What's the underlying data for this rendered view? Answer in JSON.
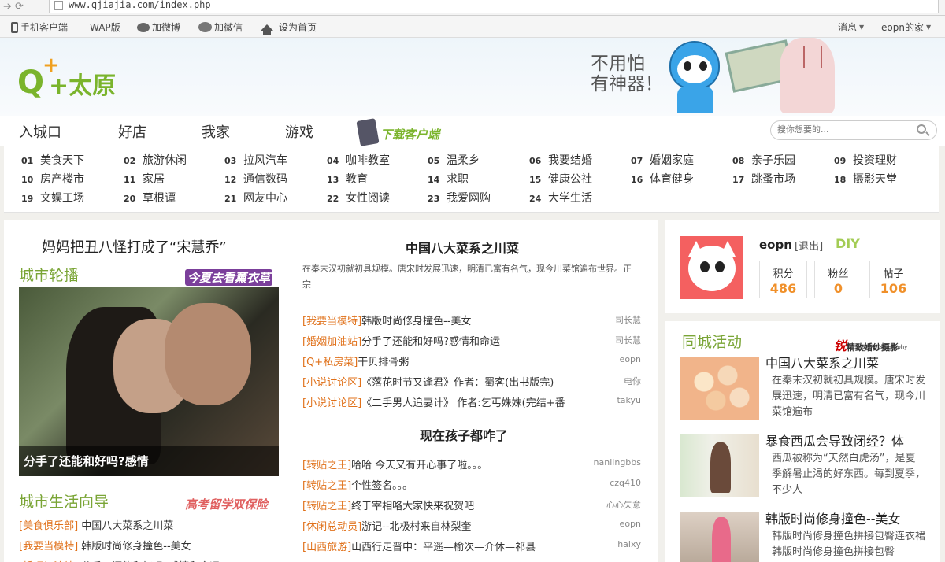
{
  "browser": {
    "url": "www.qjiajia.com/index.php"
  },
  "topbar": {
    "mobile_client": "手机客户端",
    "wap": "WAP版",
    "add_weibo": "加微博",
    "add_weixin": "加微信",
    "set_home": "设为首页",
    "messages": "消息",
    "my_home": "eopn的家"
  },
  "header": {
    "logo_plus": "+",
    "logo_text": "太原",
    "banner_line1": "不用怕",
    "banner_line2": "有神器！"
  },
  "nav": {
    "tabs": [
      "入城口",
      "好店",
      "我家",
      "游戏"
    ],
    "download": "下载客户端",
    "search_placeholder": "搜你想要的..."
  },
  "categories": [
    {
      "no": "01",
      "name": "美食天下"
    },
    {
      "no": "02",
      "name": "旅游休闲"
    },
    {
      "no": "03",
      "name": "拉风汽车"
    },
    {
      "no": "04",
      "name": "咖啡教室"
    },
    {
      "no": "05",
      "name": "温柔乡"
    },
    {
      "no": "06",
      "name": "我要结婚"
    },
    {
      "no": "07",
      "name": "婚姻家庭"
    },
    {
      "no": "08",
      "name": "亲子乐园"
    },
    {
      "no": "09",
      "name": "投资理财"
    },
    {
      "no": "10",
      "name": "房产楼市"
    },
    {
      "no": "11",
      "name": "家居"
    },
    {
      "no": "12",
      "name": "通信数码"
    },
    {
      "no": "13",
      "name": "教育"
    },
    {
      "no": "14",
      "name": "求职"
    },
    {
      "no": "15",
      "name": "健康公社"
    },
    {
      "no": "16",
      "name": "体育健身"
    },
    {
      "no": "17",
      "name": "跳蚤市场"
    },
    {
      "no": "18",
      "name": "摄影天堂"
    },
    {
      "no": "19",
      "name": "文娱工场"
    },
    {
      "no": "20",
      "name": "草根谭"
    },
    {
      "no": "21",
      "name": "网友中心"
    },
    {
      "no": "22",
      "name": "女性阅读"
    },
    {
      "no": "23",
      "name": "我爱网购"
    },
    {
      "no": "24",
      "name": "大学生活"
    }
  ],
  "left": {
    "featured_headline": "妈妈把丑八怪打成了“宋慧乔”",
    "carousel_title": "城市轮播",
    "carousel_promo": "今夏去看薰衣草",
    "carousel_caption": "分手了还能和好吗?感情",
    "carousel_active": 3,
    "guide_title": "城市生活向导",
    "guide_promo": "高考留学双保险",
    "guide_items": [
      {
        "tag": "[美食俱乐部]",
        "text": "中国八大菜系之川菜"
      },
      {
        "tag": "[我要当模特]",
        "text": "韩版时尚修身撞色--美女"
      },
      {
        "tag": "[婚姻加油站]",
        "text": "分手了还能和好吗?感情和命运"
      }
    ]
  },
  "center": {
    "block1": {
      "title": "中国八大菜系之川菜",
      "summary": "在秦末汉初就初具规模。唐宋时发展迅速，明清已富有名气，现今川菜馆遍布世界。正宗",
      "rows": [
        {
          "tag": "[我要当模特]",
          "text": "韩版时尚修身撞色--美女",
          "author": "司长慧"
        },
        {
          "tag": "[婚姻加油站]",
          "text": "分手了还能和好吗?感情和命运",
          "author": "司长慧"
        },
        {
          "tag": "[Q+私房菜]",
          "text": "干贝排骨粥",
          "author": "eopn"
        },
        {
          "tag": "[小说讨论区]",
          "text": "《落花时节又逢君》作者：蜀客(出书版完)",
          "author": "电你"
        },
        {
          "tag": "[小说讨论区]",
          "text": "《二手男人追妻计》 作者:乞丐姝姝(完结+番",
          "author": "takyu"
        }
      ]
    },
    "block2": {
      "title": "现在孩子都咋了",
      "rows": [
        {
          "tag": "[转贴之王]",
          "text": "哈哈 今天又有开心事了啦。。。",
          "author": "nanlingbbs"
        },
        {
          "tag": "[转贴之王]",
          "text": "个性签名。。。",
          "author": "czq410"
        },
        {
          "tag": "[转贴之王]",
          "text": "终于宰相咯大家快来祝贺吧",
          "author": "心心失意"
        },
        {
          "tag": "[休闲总动员]",
          "text": "游记--北极村来自林梨奎",
          "author": "eopn"
        },
        {
          "tag": "[山西旅游]",
          "text": "山西行走晋中：平遥—榆次—介休—祁县",
          "author": "halxy"
        }
      ]
    }
  },
  "user": {
    "name": "eopn",
    "logout": "[退出]",
    "diy": "DIY",
    "stats": [
      {
        "label": "积分",
        "value": "486"
      },
      {
        "label": "粉丝",
        "value": "0"
      },
      {
        "label": "帖子",
        "value": "106"
      }
    ]
  },
  "activities": {
    "title": "同城活动",
    "sponsor_mark": "锐",
    "sponsor": "精致婚纱摄影",
    "sponsor_en": "Sharp Photography",
    "items": [
      {
        "title": "中国八大菜系之川菜",
        "summary": "在秦末汉初就初具规模。唐宋时发展迅速，明清已富有名气，现今川菜馆遍布"
      },
      {
        "title": "暴食西瓜会导致闭经？体",
        "summary": "西瓜被称为“天然白虎汤”，是夏季解暑止渴的好东西。每到夏季，不少人"
      },
      {
        "title": "韩版时尚修身撞色--美女",
        "summary": "韩版时尚修身撞色拼接包臀连衣裙 韩版时尚修身撞色拼接包臀"
      }
    ]
  }
}
